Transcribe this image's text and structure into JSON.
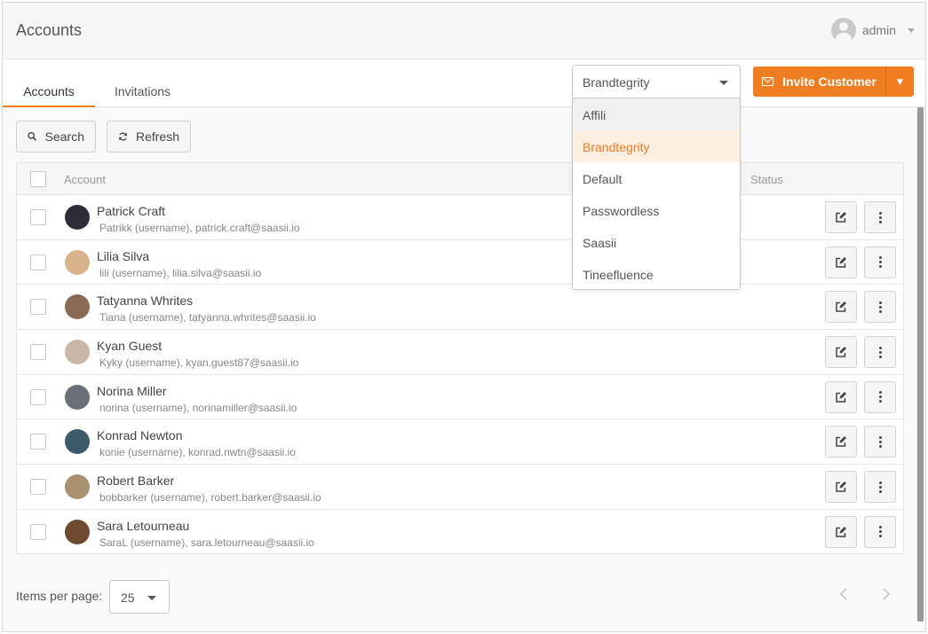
{
  "header": {
    "title": "Accounts",
    "user": "admin"
  },
  "tabs": [
    {
      "label": "Accounts"
    },
    {
      "label": "Invitations"
    }
  ],
  "brand_select": {
    "value": "Brandtegrity",
    "options": [
      "Affili",
      "Brandtegrity",
      "Default",
      "Passwordless",
      "Saasii",
      "Tineefluence"
    ]
  },
  "invite": {
    "label": "Invite Customer"
  },
  "toolbar": {
    "search": "Search",
    "refresh": "Refresh"
  },
  "table": {
    "columns": {
      "account": "Account",
      "status": "Status"
    },
    "rows": [
      {
        "name": "Patrick Craft",
        "sub": "Patrikk (username), patrick.craft@saasii.io"
      },
      {
        "name": "Lilia Silva",
        "sub": "lili (username), lilia.silva@saasii.io"
      },
      {
        "name": "Tatyanna Whrites",
        "sub": "Tiana (username), tatyanna.whrites@saasii.io"
      },
      {
        "name": "Kyan Guest",
        "sub": "Kyky (username), kyan.guest87@saasii.io"
      },
      {
        "name": "Norina Miller",
        "sub": "norina (username), norinamiller@saasii.io"
      },
      {
        "name": "Konrad Newton",
        "sub": "konie (username), konrad.nwtn@saasii.io"
      },
      {
        "name": "Robert Barker",
        "sub": "bobbarker (username), robert.barker@saasii.io"
      },
      {
        "name": "Sara Letourneau",
        "sub": "SaraL (username), sara.letourneau@saasii.io"
      }
    ]
  },
  "pagination": {
    "label": "Items per page:",
    "per_page": "25"
  },
  "colors": {
    "accent": "#ef7d22"
  }
}
